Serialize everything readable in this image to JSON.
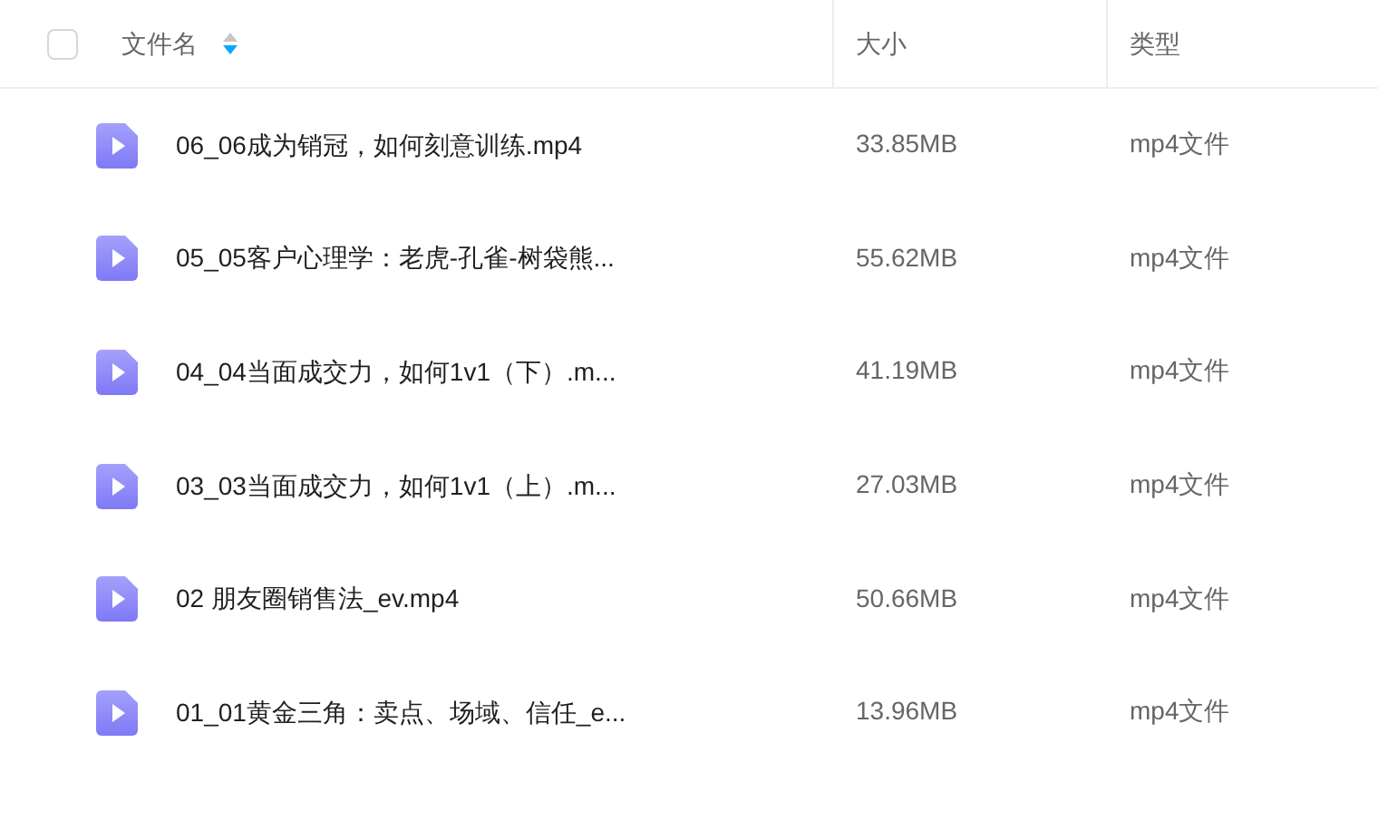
{
  "table": {
    "select_all": {
      "checked": false
    },
    "columns": [
      {
        "label": "文件名",
        "sorted_descending": true
      },
      {
        "label": "大小"
      },
      {
        "label": "类型"
      }
    ],
    "rows": [
      {
        "name": "06_06成为销冠，如何刻意训练.mp4",
        "size": "33.85MB",
        "type": "mp4文件"
      },
      {
        "name": "05_05客户心理学：老虎-孔雀-树袋熊...",
        "size": "55.62MB",
        "type": "mp4文件"
      },
      {
        "name": "04_04当面成交力，如何1v1（下）.m...",
        "size": "41.19MB",
        "type": "mp4文件"
      },
      {
        "name": "03_03当面成交力，如何1v1（上）.m...",
        "size": "27.03MB",
        "type": "mp4文件"
      },
      {
        "name": "02 朋友圈销售法_ev.mp4",
        "size": "50.66MB",
        "type": "mp4文件"
      },
      {
        "name": "01_01黄金三角：卖点、场域、信任_e...",
        "size": "13.96MB",
        "type": "mp4文件"
      }
    ]
  }
}
